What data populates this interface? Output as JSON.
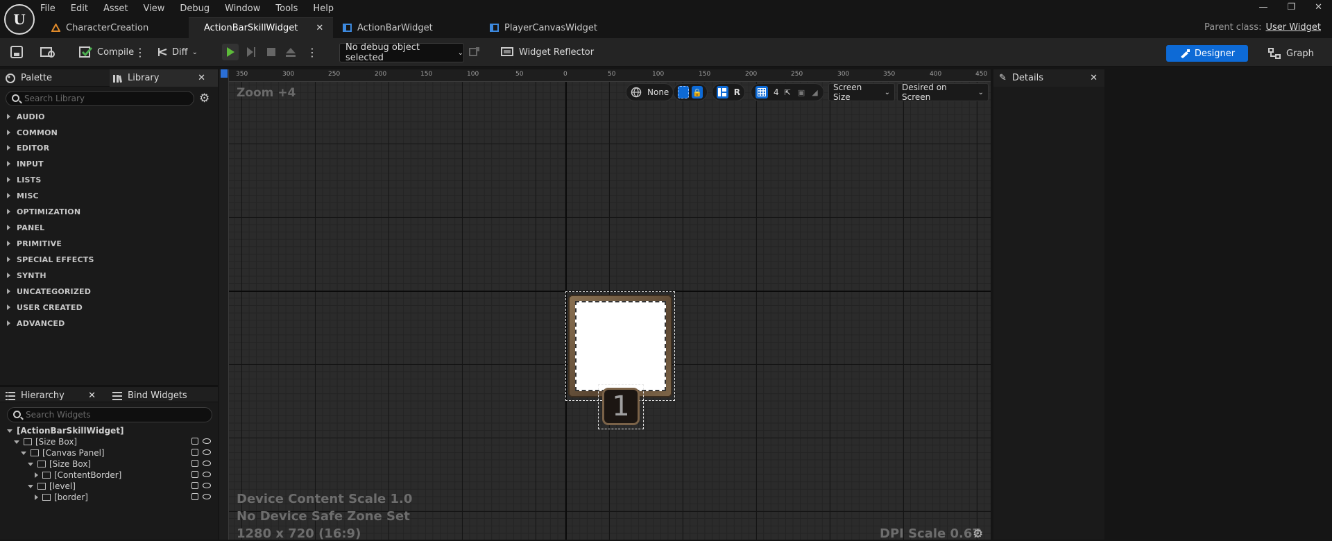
{
  "menu": [
    "File",
    "Edit",
    "Asset",
    "View",
    "Debug",
    "Window",
    "Tools",
    "Help"
  ],
  "tabs": [
    {
      "label": "CharacterCreation",
      "active": false
    },
    {
      "label": "ActionBarSkillWidget",
      "active": true
    },
    {
      "label": "ActionBarWidget",
      "active": false
    },
    {
      "label": "PlayerCanvasWidget",
      "active": false
    }
  ],
  "parent_class": {
    "label": "Parent class:",
    "value": "User Widget"
  },
  "toolbar": {
    "compile": "Compile",
    "diff": "Diff",
    "debug_select": "No debug object selected",
    "widget_reflector": "Widget Reflector",
    "designer": "Designer",
    "graph": "Graph"
  },
  "palette": {
    "tab_palette": "Palette",
    "tab_library": "Library",
    "search_placeholder": "Search Library",
    "categories": [
      "AUDIO",
      "COMMON",
      "EDITOR",
      "INPUT",
      "LISTS",
      "MISC",
      "OPTIMIZATION",
      "PANEL",
      "PRIMITIVE",
      "SPECIAL EFFECTS",
      "SYNTH",
      "UNCATEGORIZED",
      "USER CREATED",
      "ADVANCED"
    ]
  },
  "hierarchy": {
    "tab_hierarchy": "Hierarchy",
    "tab_bind": "Bind Widgets",
    "search_placeholder": "Search Widgets",
    "nodes": [
      {
        "label": "[ActionBarSkillWidget]"
      },
      {
        "label": "[Size Box]"
      },
      {
        "label": "[Canvas Panel]"
      },
      {
        "label": "[Size Box]"
      },
      {
        "label": "[ContentBorder]"
      },
      {
        "label": "[level]"
      },
      {
        "label": "[border]"
      }
    ]
  },
  "viewport": {
    "zoom": "Zoom +4",
    "none_label": "None",
    "r_label": "R",
    "grid_num": "4",
    "screen_size": "Screen Size",
    "desired": "Desired on Screen",
    "device_scale": "Device Content Scale 1.0",
    "safe_zone": "No Device Safe Zone Set",
    "resolution": "1280 x 720 (16:9)",
    "dpi": "DPI Scale 0.67",
    "level_text": "1",
    "h_ruler": [
      "350",
      "300",
      "250",
      "200",
      "150",
      "100",
      "50",
      "0",
      "50",
      "100",
      "150",
      "200",
      "250",
      "300",
      "350",
      "400",
      "450"
    ]
  },
  "details": {
    "title": "Details"
  }
}
